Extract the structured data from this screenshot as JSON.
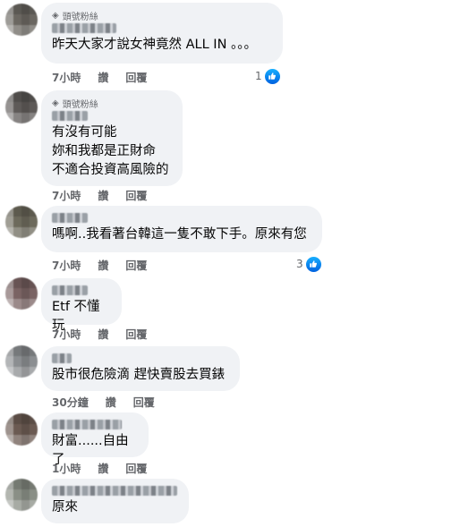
{
  "badge_label": "頭號粉絲",
  "actions": {
    "like": "讚",
    "reply": "回覆"
  },
  "comments": [
    {
      "text": "昨天大家才說女神竟然 ALL IN 。。。",
      "time": "7小時",
      "reactions": "1"
    },
    {
      "text": "有沒有可能\n妳和我都是正財命\n不適合投資高風險的",
      "time": "7小時",
      "reactions": ""
    },
    {
      "text": "嗎啊..我看著台韓這一隻不敢下手。原來有您",
      "time": "7小時",
      "reactions": "3"
    },
    {
      "text": "Etf 不懂玩",
      "time": "7小時",
      "reactions": ""
    },
    {
      "text": "股市很危險滴 趕快賣股去買錶",
      "time": "30分鐘",
      "reactions": ""
    },
    {
      "text": "財富......自由了",
      "time": "1小時",
      "reactions": ""
    },
    {
      "text": "原來",
      "time": "",
      "reactions": ""
    }
  ],
  "colors": {
    "bubble": "#f0f2f5",
    "meta": "#65676b",
    "like": "#0866ff"
  }
}
